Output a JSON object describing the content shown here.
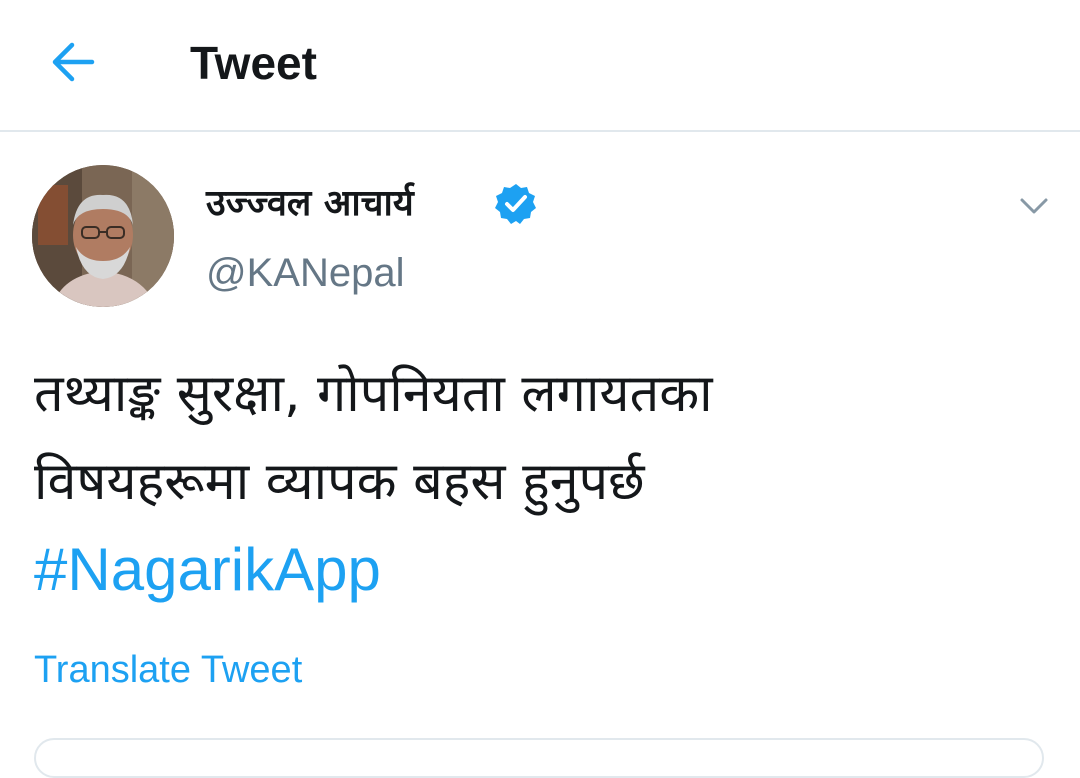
{
  "header": {
    "title": "Tweet",
    "back_icon": "arrow-left-icon"
  },
  "tweet": {
    "author": {
      "display_name": "उज्ज्वल आचार्य",
      "handle": "@KANepal",
      "verified": true,
      "verified_icon": "verified-badge-icon"
    },
    "text_lines": [
      "तथ्याङ्क सुरक्षा, गोपनियता लगायतका",
      "विषयहरूमा व्यापक बहस हुनुपर्छ"
    ],
    "hashtag": "#NagarikApp",
    "translate_label": "Translate Tweet",
    "menu_icon": "chevron-down-icon"
  },
  "colors": {
    "accent": "#1da1f2",
    "text_primary": "#14171a",
    "text_secondary": "#657786",
    "divider": "#e1e8ed"
  }
}
